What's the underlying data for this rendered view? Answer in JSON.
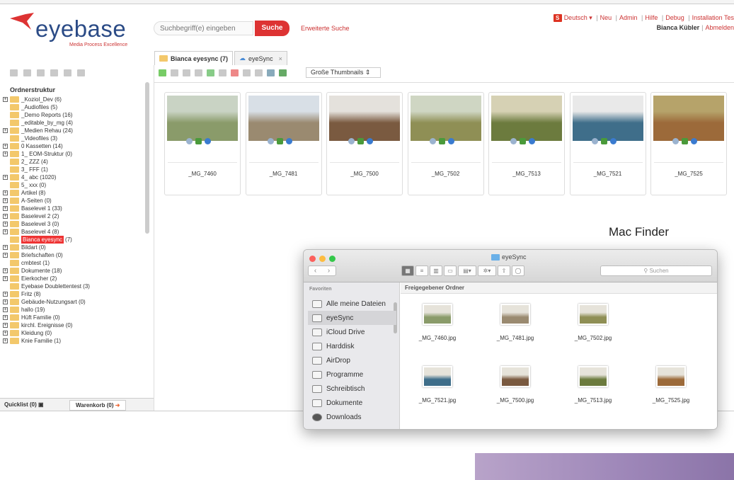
{
  "header": {
    "logo_text": "eyebase",
    "logo_tagline": "Media Process Excellence",
    "search_placeholder": "Suchbegriff(e) eingeben",
    "search_button": "Suche",
    "advanced_search": "Erweiterte Suche",
    "language": "Deutsch",
    "language_flag": "S",
    "links": [
      "Neu",
      "Admin",
      "Hilfe",
      "Debug",
      "Installation Tes"
    ],
    "user_name": "Bianca Kübler",
    "logout": "Abmelden"
  },
  "sidebar": {
    "root_label": "Ordnerstruktur",
    "items": [
      {
        "label": "_Koziol_Dev (6)",
        "expandable": true
      },
      {
        "label": "_Audiofiles (5)",
        "expandable": false
      },
      {
        "label": "_Demo Reports (16)",
        "expandable": false
      },
      {
        "label": "_editable_by_mg (4)",
        "expandable": false
      },
      {
        "label": "_Medien Rehau (24)",
        "expandable": true
      },
      {
        "label": "_Videofiles (3)",
        "expandable": false
      },
      {
        "label": "0 Kassetten (14)",
        "expandable": true
      },
      {
        "label": "1_ EOM-Struktur (0)",
        "expandable": true
      },
      {
        "label": "2_ ZZZ (4)",
        "expandable": false
      },
      {
        "label": "3_ FFF (1)",
        "expandable": false
      },
      {
        "label": "4_ abc (1020)",
        "expandable": true
      },
      {
        "label": "5_ xxx (0)",
        "expandable": false
      },
      {
        "label": "Artikel (8)",
        "expandable": true
      },
      {
        "label": "A-Seiten (0)",
        "expandable": true
      },
      {
        "label": "Baselevel 1 (33)",
        "expandable": true
      },
      {
        "label": "Baselevel 2 (2)",
        "expandable": true
      },
      {
        "label": "Baselevel 3 (0)",
        "expandable": true
      },
      {
        "label": "Baselevel 4 (8)",
        "expandable": true
      },
      {
        "label": "Bianca eyesync",
        "count": "(7)",
        "expandable": false,
        "selected": true
      },
      {
        "label": "Bildart (0)",
        "expandable": true
      },
      {
        "label": "Briefschaften (0)",
        "expandable": true
      },
      {
        "label": "cmbtest (1)",
        "expandable": false
      },
      {
        "label": "Dokumente (18)",
        "expandable": true
      },
      {
        "label": "Eierkocher (2)",
        "expandable": true
      },
      {
        "label": "Eyebase Doublettentest (3)",
        "expandable": false
      },
      {
        "label": "Fritz (8)",
        "expandable": true
      },
      {
        "label": "Gebäude-Nutzungsart (0)",
        "expandable": true
      },
      {
        "label": "hallo (19)",
        "expandable": true
      },
      {
        "label": "Hüft Familie (0)",
        "expandable": true
      },
      {
        "label": "kirchl. Ereignisse (0)",
        "expandable": true
      },
      {
        "label": "Kleidung (0)",
        "expandable": true
      },
      {
        "label": "Knie Familie (1)",
        "expandable": true
      }
    ],
    "quicklist": "Quicklist (0)",
    "warenkorb": "Warenkorb (0)"
  },
  "tabs": [
    {
      "label": "Bianca eyesync (7)",
      "active": true
    },
    {
      "label": "eyeSync",
      "active": false
    }
  ],
  "view_select": "Große Thumbnails",
  "thumbnails": [
    {
      "name": "_MG_7460",
      "c1": "#8a9b6a",
      "c2": "#c9d3c4"
    },
    {
      "name": "_MG_7481",
      "c1": "#9a8a70",
      "c2": "#d8dfe6"
    },
    {
      "name": "_MG_7500",
      "c1": "#7a5a40",
      "c2": "#e4e1dc"
    },
    {
      "name": "_MG_7502",
      "c1": "#8f8f55",
      "c2": "#cfd6c3"
    },
    {
      "name": "_MG_7513",
      "c1": "#6c7b3e",
      "c2": "#d6d1b4"
    },
    {
      "name": "_MG_7521",
      "c1": "#3f6e8a",
      "c2": "#e9e9e9"
    },
    {
      "name": "_MG_7525",
      "c1": "#9c6a3a",
      "c2": "#b6a36a"
    }
  ],
  "annotation": "Mac Finder",
  "finder": {
    "title": "eyeSync",
    "search_placeholder": "Suchen",
    "favorites_header": "Favoriten",
    "sidebar": [
      "Alle meine Dateien",
      "eyeSync",
      "iCloud Drive",
      "Harddisk",
      "AirDrop",
      "Programme",
      "Schreibtisch",
      "Dokumente",
      "Downloads"
    ],
    "content_header": "Freigegebener Ordner",
    "files": [
      {
        "name": "_MG_7460.jpg",
        "c1": "#8a9b6a"
      },
      {
        "name": "_MG_7481.jpg",
        "c1": "#9a8a70"
      },
      {
        "name": "_MG_7502.jpg",
        "c1": "#8f8f55"
      },
      {
        "name": "_MG_7521.jpg",
        "c1": "#3f6e8a"
      },
      {
        "name": "_MG_7500.jpg",
        "c1": "#7a5a40"
      },
      {
        "name": "_MG_7513.jpg",
        "c1": "#6c7b3e"
      },
      {
        "name": "_MG_7525.jpg",
        "c1": "#9c6a3a"
      }
    ]
  },
  "colors": {
    "accent": "#dd3333",
    "brand": "#2b4b86",
    "folder": "#f3c86b"
  }
}
